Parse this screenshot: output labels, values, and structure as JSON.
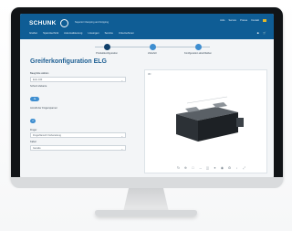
{
  "header": {
    "logo": "SCHUNK",
    "tagline": "Superior Clamping and Gripping",
    "toplinks": [
      "Jobs",
      "Service",
      "Presse",
      "Kontakt"
    ],
    "nav": [
      "Greifen",
      "Spanntechnik",
      "Automatisierung",
      "Lösungen",
      "Service",
      "Unternehmen"
    ],
    "icons": [
      "user-icon",
      "cart-icon"
    ]
  },
  "steps": [
    {
      "label": "Produktkonfiguration"
    },
    {
      "label": "Zubehör"
    },
    {
      "label": "Konfiguration abschließen"
    }
  ],
  "main": {
    "title": "Greiferkonfiguration ELG"
  },
  "form": {
    "fields": [
      {
        "label": "Baugröße wählen",
        "value": "ELG 100"
      },
      {
        "label": "Schutz-Variante",
        "value": "Ja"
      },
      {
        "label": "Anzahl der Fingerspanner",
        "value": "2"
      },
      {
        "label": "Finger",
        "value": "Fingerflansch Vorbereitung"
      },
      {
        "label": "Kabel",
        "value": "Gerade"
      }
    ]
  },
  "viewer": {
    "label": "3D",
    "toolbar": [
      "rotate-icon",
      "zoom-icon",
      "fit-icon",
      "measure-icon",
      "section-icon",
      "color-icon",
      "view-icon",
      "settings-icon",
      "download-icon",
      "fullscreen-icon"
    ]
  },
  "colors": {
    "brand": "#0f5d95",
    "accent": "#3e8ed0"
  }
}
